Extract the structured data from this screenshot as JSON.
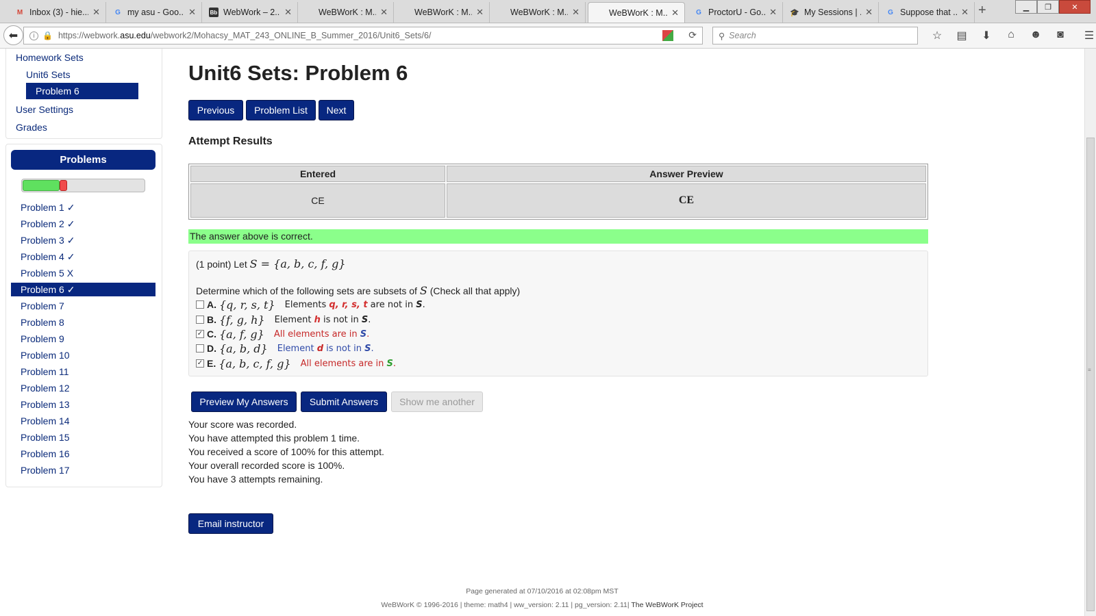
{
  "browser": {
    "tabs": [
      {
        "title": "Inbox (3) - hie...",
        "icon": "M",
        "icon_color": "#d44638"
      },
      {
        "title": "my asu - Goo...",
        "icon": "G",
        "icon_color": "#4285f4"
      },
      {
        "title": "WebWork – 2...",
        "icon": "Bb",
        "icon_color": "#333333"
      },
      {
        "title": "WeBWorK : M...",
        "icon": "",
        "icon_color": ""
      },
      {
        "title": "WeBWorK : M...",
        "icon": "",
        "icon_color": ""
      },
      {
        "title": "WeBWorK : M...",
        "icon": "",
        "icon_color": ""
      },
      {
        "title": "WeBWorK : M...",
        "icon": "",
        "icon_color": ""
      },
      {
        "title": "ProctorU - Go...",
        "icon": "G",
        "icon_color": "#4285f4"
      },
      {
        "title": "My Sessions | ...",
        "icon": "🎓",
        "icon_color": "#2266aa"
      },
      {
        "title": "Suppose that ...",
        "icon": "G",
        "icon_color": "#4285f4"
      }
    ],
    "active_tab": 6,
    "url_prefix": "https://webwork.",
    "url_domain": "asu.edu",
    "url_path": "/webwork2/Mohacsy_MAT_243_ONLINE_B_Summer_2016/Unit6_Sets/6/",
    "search_placeholder": "Search"
  },
  "sidebar": {
    "links": {
      "homework_sets": "Homework Sets",
      "unit6_sets": "Unit6 Sets",
      "problem6": "Problem 6",
      "user_settings": "User Settings",
      "grades": "Grades"
    },
    "problems_header": "Problems",
    "progress": {
      "correct_fraction": 0.3,
      "incorrect_fraction": 0.06
    },
    "problems": [
      {
        "label": "Problem 1 ✓"
      },
      {
        "label": "Problem 2 ✓"
      },
      {
        "label": "Problem 3 ✓"
      },
      {
        "label": "Problem 4 ✓"
      },
      {
        "label": "Problem 5 X"
      },
      {
        "label": "Problem 6 ✓",
        "active": true
      },
      {
        "label": "Problem 7"
      },
      {
        "label": "Problem 8"
      },
      {
        "label": "Problem 9"
      },
      {
        "label": "Problem 10"
      },
      {
        "label": "Problem 11"
      },
      {
        "label": "Problem 12"
      },
      {
        "label": "Problem 13"
      },
      {
        "label": "Problem 14"
      },
      {
        "label": "Problem 15"
      },
      {
        "label": "Problem 16"
      },
      {
        "label": "Problem 17"
      }
    ]
  },
  "main": {
    "title": "Unit6 Sets: Problem 6",
    "nav_buttons": {
      "previous": "Previous",
      "problem_list": "Problem List",
      "next": "Next"
    },
    "attempt_results_heading": "Attempt Results",
    "results_table": {
      "headers": [
        "Entered",
        "Answer Preview"
      ],
      "row": [
        "CE",
        "CE"
      ]
    },
    "correct_message": "The answer above is correct.",
    "problem": {
      "points": "(1 point) Let",
      "set_def": "S = {a, b, c, f, g}",
      "instruction_pre": "Determine which of the following sets are subsets of",
      "instruction_var": "S",
      "instruction_post": "(Check all that apply)",
      "options": [
        {
          "letter": "A.",
          "set": "{q, r, s, t}",
          "checked": false,
          "hint_pre": "Elements ",
          "hint_vars": "q, r, s, t",
          "hint_mid": " are not in ",
          "hint_s": "S",
          "hint_end": "."
        },
        {
          "letter": "B.",
          "set": "{f, g, h}",
          "checked": false,
          "hint_pre": "Element ",
          "hint_vars": "h",
          "hint_mid": " is not in ",
          "hint_s": "S",
          "hint_end": "."
        },
        {
          "letter": "C.",
          "set": "{a, f, g}",
          "checked": true,
          "hint_pre": "All elements are in ",
          "hint_s": "S",
          "hint_end": "."
        },
        {
          "letter": "D.",
          "set": "{a, b, d}",
          "checked": false,
          "hint_pre": "Element ",
          "hint_vars": "d",
          "hint_mid": " is not in ",
          "hint_s": "S",
          "hint_end": "."
        },
        {
          "letter": "E.",
          "set": "{a, b, c, f, g}",
          "checked": true,
          "hint_pre": "All elements are in ",
          "hint_s": "S",
          "hint_end": "."
        }
      ]
    },
    "action_buttons": {
      "preview": "Preview My Answers",
      "submit": "Submit Answers",
      "show_another": "Show me another"
    },
    "score_lines": [
      "Your score was recorded.",
      "You have attempted this problem 1 time.",
      "You received a score of 100% for this attempt.",
      "Your overall recorded score is 100%.",
      "You have 3 attempts remaining."
    ],
    "email_button": "Email instructor"
  },
  "footer": {
    "generated": "Page generated at 07/10/2016 at 02:08pm MST",
    "copyright": "WeBWorK © 1996-2016 | theme: math4 | ww_version: 2.11 | pg_version: 2.11|",
    "project": "The WeBWorK Project"
  },
  "colors": {
    "accent": "#082780",
    "correct": "#8bff8b",
    "progress_ok": "#5fe05f",
    "progress_bad": "#f04b4b"
  }
}
